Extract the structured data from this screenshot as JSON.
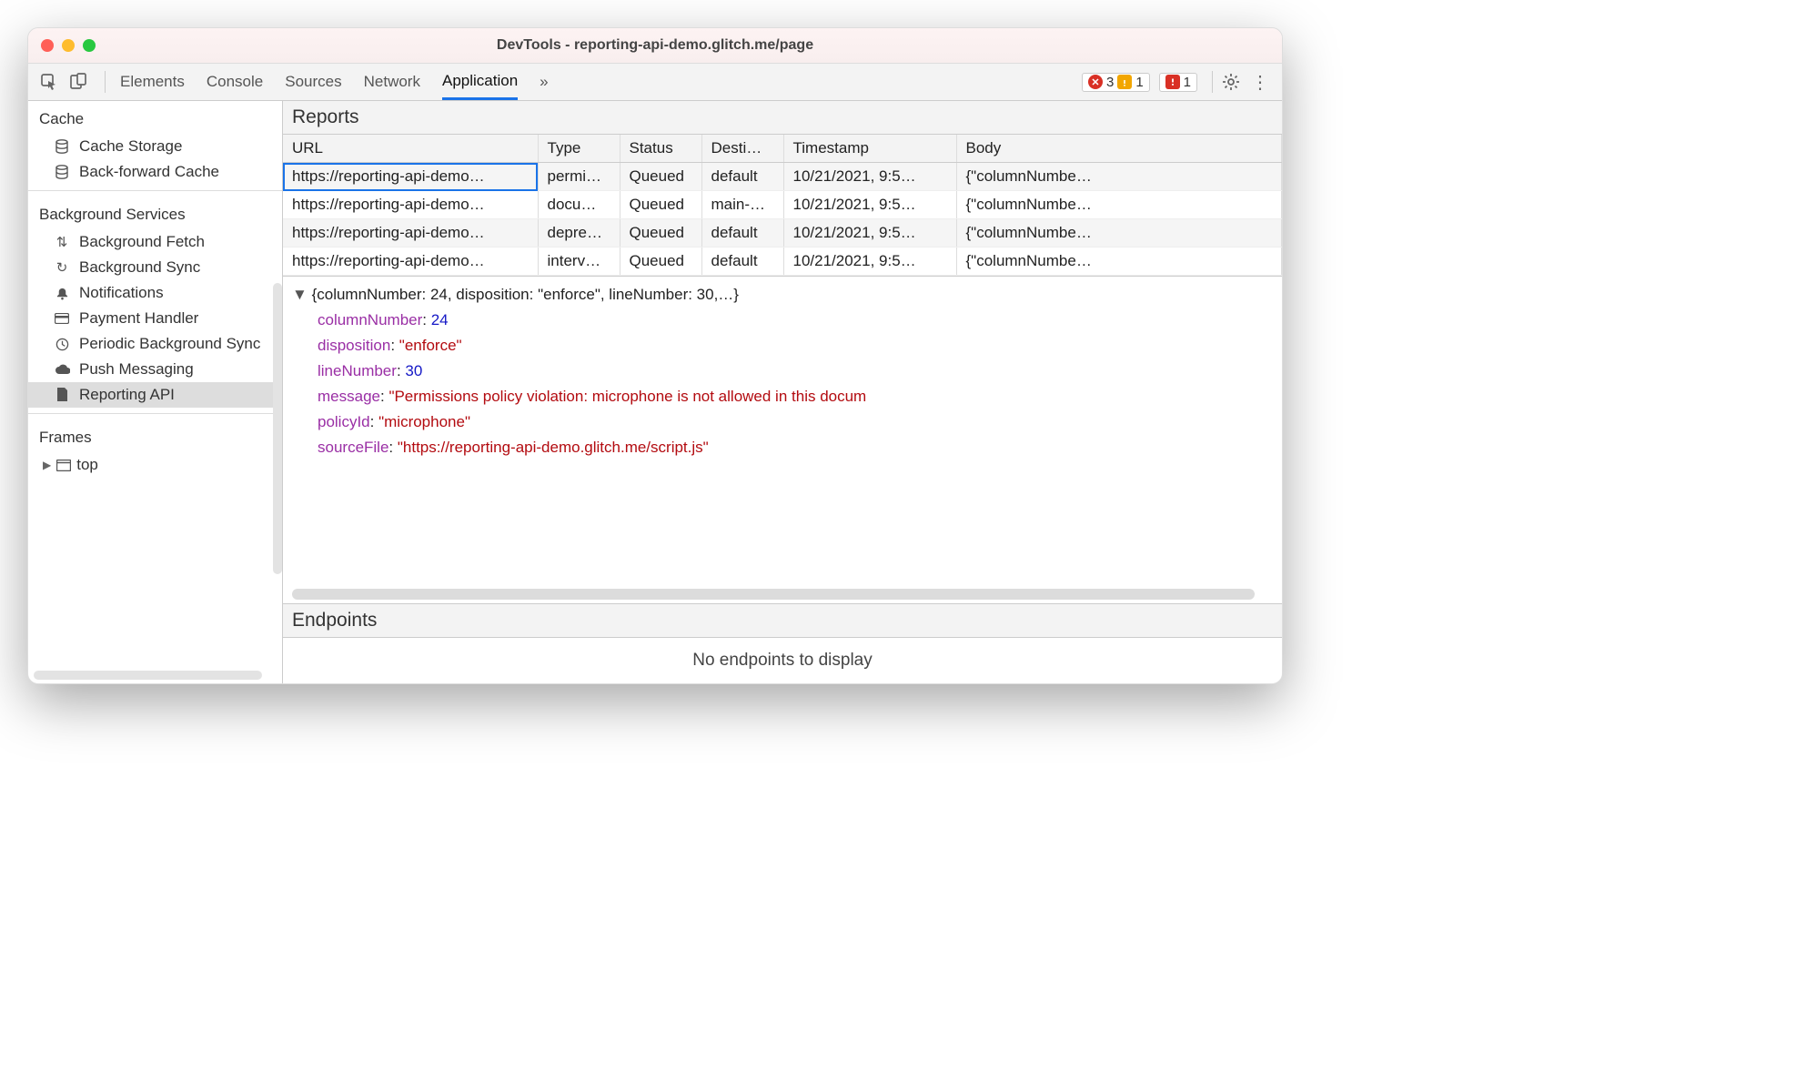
{
  "window": {
    "title": "DevTools - reporting-api-demo.glitch.me/page"
  },
  "tabs": {
    "items": [
      "Elements",
      "Console",
      "Sources",
      "Network",
      "Application"
    ],
    "active": "Application",
    "more": "»"
  },
  "counters": {
    "errors": "3",
    "warnings": "1",
    "issues": "1"
  },
  "sidebar": {
    "cache": {
      "label": "Cache",
      "items": [
        "Cache Storage",
        "Back-forward Cache"
      ]
    },
    "bg": {
      "label": "Background Services",
      "items": [
        "Background Fetch",
        "Background Sync",
        "Notifications",
        "Payment Handler",
        "Periodic Background Sync",
        "Push Messaging",
        "Reporting API"
      ]
    },
    "frames": {
      "label": "Frames",
      "top": "top"
    }
  },
  "reports": {
    "title": "Reports",
    "headers": {
      "url": "URL",
      "type": "Type",
      "status": "Status",
      "dest": "Desti…",
      "ts": "Timestamp",
      "body": "Body"
    },
    "rows": [
      {
        "url": "https://reporting-api-demo…",
        "type": "permi…",
        "status": "Queued",
        "dest": "default",
        "ts": "10/21/2021, 9:5…",
        "body": "{\"columnNumbe…"
      },
      {
        "url": "https://reporting-api-demo…",
        "type": "docu…",
        "status": "Queued",
        "dest": "main-…",
        "ts": "10/21/2021, 9:5…",
        "body": "{\"columnNumbe…"
      },
      {
        "url": "https://reporting-api-demo…",
        "type": "depre…",
        "status": "Queued",
        "dest": "default",
        "ts": "10/21/2021, 9:5…",
        "body": "{\"columnNumbe…"
      },
      {
        "url": "https://reporting-api-demo…",
        "type": "interv…",
        "status": "Queued",
        "dest": "default",
        "ts": "10/21/2021, 9:5…",
        "body": "{\"columnNumbe…"
      }
    ]
  },
  "detail": {
    "summary": "{columnNumber: 24, disposition: \"enforce\", lineNumber: 30,…}",
    "columnNumber_k": "columnNumber",
    "columnNumber_v": "24",
    "disposition_k": "disposition",
    "disposition_v": "\"enforce\"",
    "lineNumber_k": "lineNumber",
    "lineNumber_v": "30",
    "message_k": "message",
    "message_v": "\"Permissions policy violation: microphone is not allowed in this docum",
    "policyId_k": "policyId",
    "policyId_v": "\"microphone\"",
    "sourceFile_k": "sourceFile",
    "sourceFile_v": "\"https://reporting-api-demo.glitch.me/script.js\""
  },
  "endpoints": {
    "title": "Endpoints",
    "empty": "No endpoints to display"
  }
}
